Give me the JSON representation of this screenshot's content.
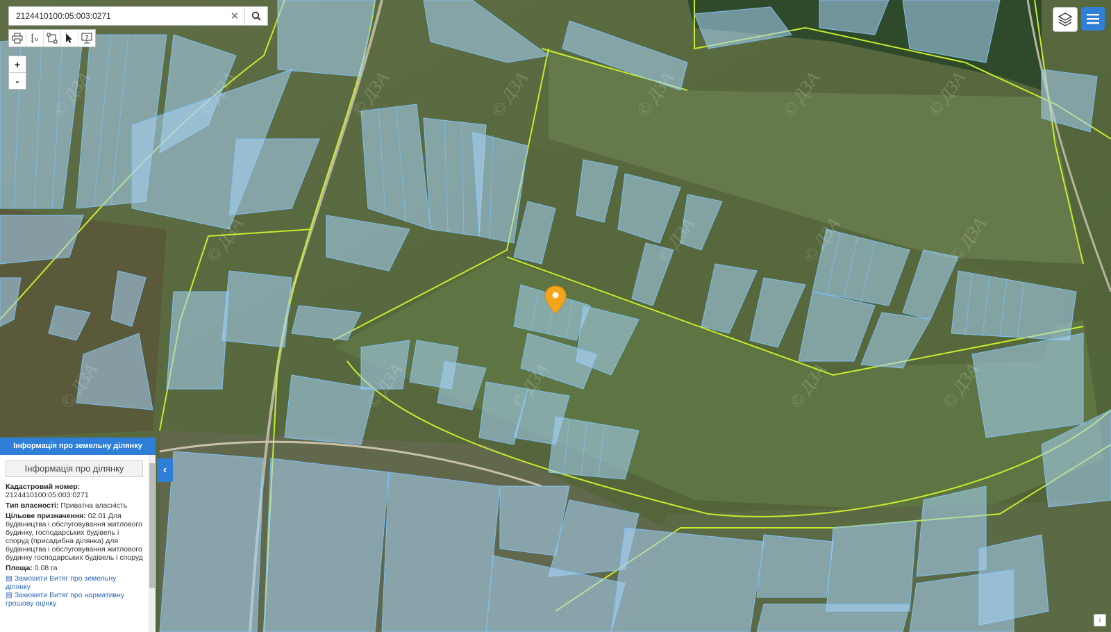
{
  "search": {
    "value": "2124410100:05:003:0271"
  },
  "toolbar": {
    "tools": [
      "printer-icon",
      "measure-icon",
      "select-area-icon",
      "pointer-icon",
      "help-screen-icon"
    ]
  },
  "zoom": {
    "in": "+",
    "out": "-"
  },
  "map": {
    "watermark": "© ДЗА",
    "colors": {
      "parcel_fill": "#a9d4f7",
      "parcel_stroke": "#7cc0f2",
      "boundary": "#c6ec2e",
      "marker": "#f4a51c"
    }
  },
  "panel": {
    "header": "Інформація про земельну ділянку",
    "subheader": "Інформація про ділянку",
    "cadastral_label": "Кадастровий номер:",
    "cadastral_value": "2124410100:05:003:0271",
    "ownership_label": "Тип власності:",
    "ownership_value": "Приватна власність",
    "purpose_label": "Цільове призначення:",
    "purpose_value": "02.01 Для будівництва і обслуговування житлового будинку, господарських будівель і споруд (присадибна ділянка) для будівництва і обслуговування житлового будинку господарських будівель і споруд",
    "area_label": "Площа:",
    "area_value": "0.08 га",
    "link1": "Замовити Витяг про земельну ділянку",
    "link2": "Замовити Витяг про нормативну грошову оцінку"
  },
  "collapse": "‹",
  "info": "i"
}
